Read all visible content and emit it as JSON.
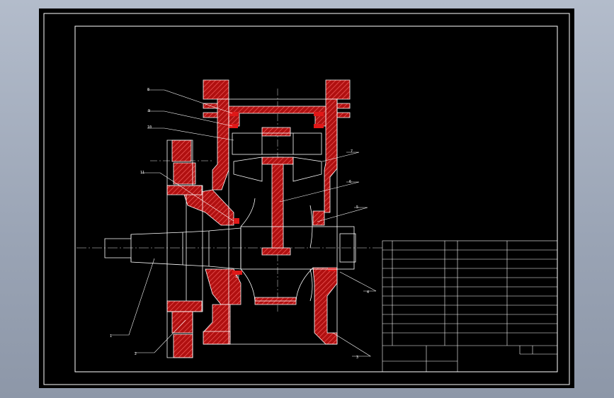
{
  "viewport": {
    "background": "#000000"
  },
  "colors": {
    "outline": "#ffffff",
    "section": "#c41414",
    "hatch": "#ff5555",
    "centerline": "#e0e0e0"
  },
  "balloons": {
    "b1": "1",
    "b2": "2",
    "b3": "3",
    "b4": "4",
    "b5": "5",
    "b6": "6",
    "b7": "7",
    "b8": "8",
    "b9": "9",
    "b10": "10",
    "b11": "11",
    "b12": "12"
  },
  "title_block": {
    "rows": 11,
    "filled": false
  }
}
